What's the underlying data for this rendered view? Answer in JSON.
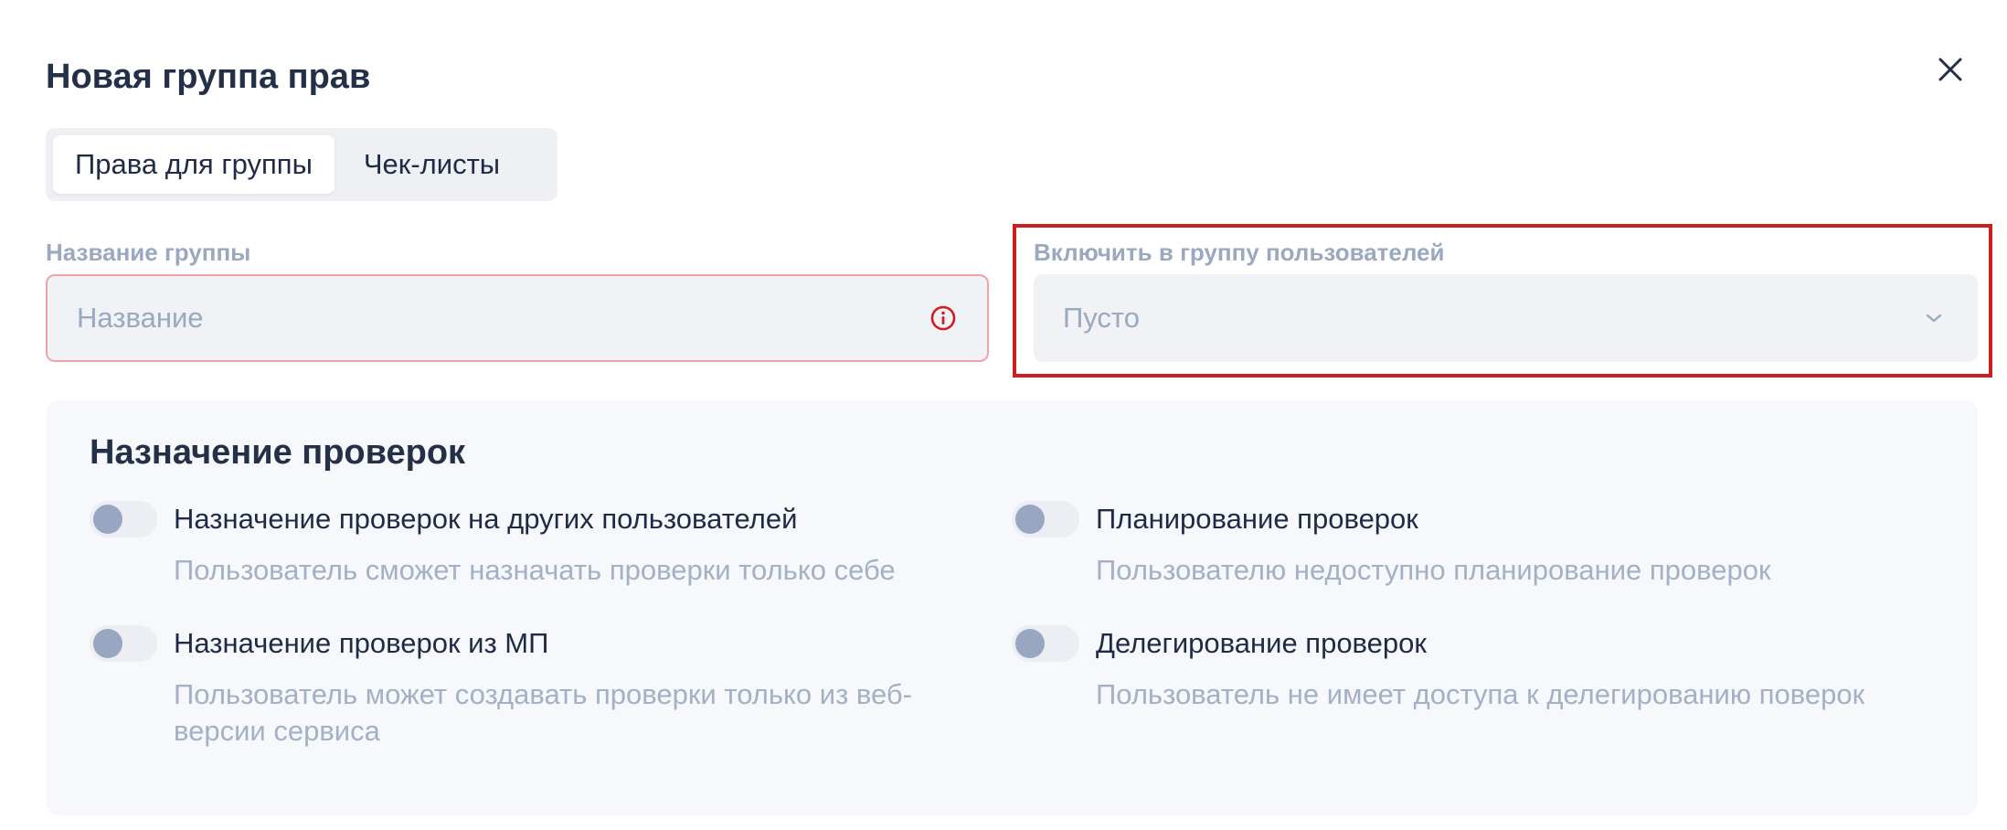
{
  "dialog": {
    "title": "Новая группа прав",
    "close_icon": "close-icon"
  },
  "tabs": [
    {
      "label": "Права для группы",
      "active": true
    },
    {
      "label": "Чек-листы",
      "active": false
    }
  ],
  "group_name": {
    "label": "Название группы",
    "placeholder": "Название",
    "state": "error",
    "trailing_icon": "error-info-icon"
  },
  "include_users": {
    "label": "Включить в группу пользователей",
    "value": "Пусто",
    "trailing_icon": "chevron-down-icon"
  },
  "assignments": {
    "title": "Назначение проверок",
    "options": [
      {
        "title": "Назначение проверок на других пользователей",
        "desc": "Пользователь сможет назначать проверки только себе",
        "enabled": false
      },
      {
        "title": "Планирование проверок",
        "desc": "Пользователю недоступно планирование проверок",
        "enabled": false
      },
      {
        "title": "Назначение проверок из МП",
        "desc": "Пользователь может создавать проверки только из веб-версии сервиса",
        "enabled": false
      },
      {
        "title": "Делегирование проверок",
        "desc": "Пользователь не имеет доступа к делегированию поверок",
        "enabled": false
      }
    ]
  },
  "colors": {
    "error_border": "#f0a2a6",
    "error_icon": "#d01c1c",
    "highlight": "#cc1f1f",
    "text_primary": "#1f2b46",
    "text_muted": "#9aa8c0"
  }
}
